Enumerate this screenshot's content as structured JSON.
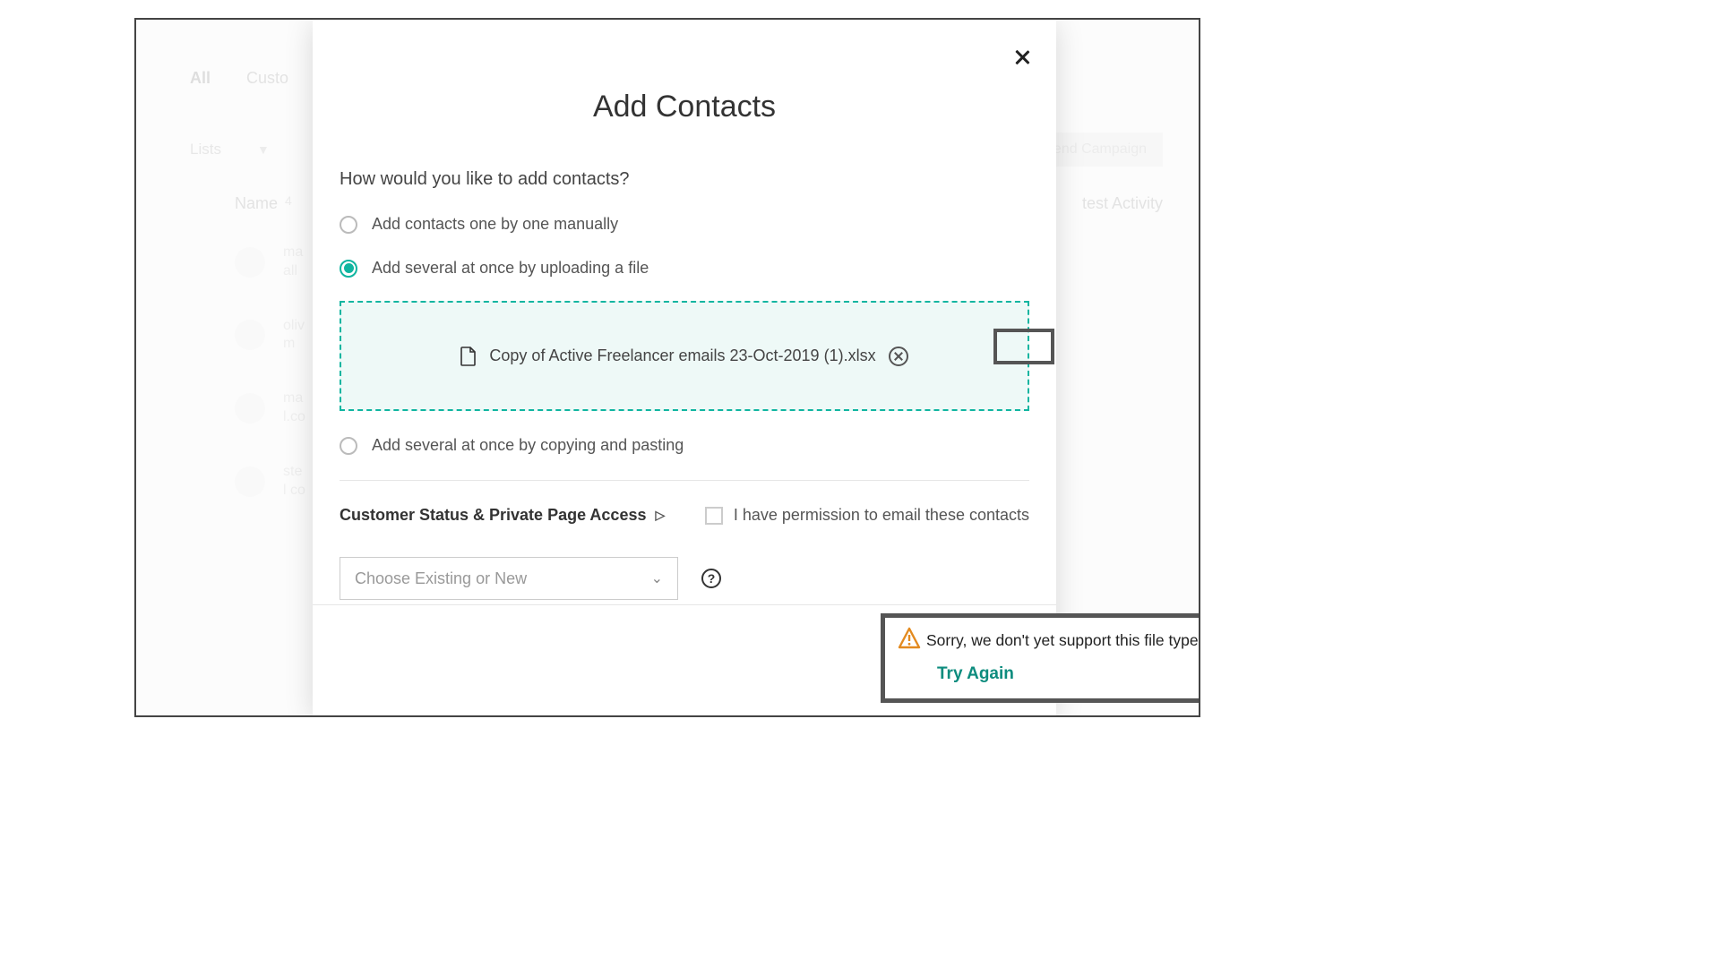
{
  "background": {
    "tabs": {
      "all": "All",
      "customers": "Custo"
    },
    "lists_label": "Lists",
    "send_campaign": "end Campaign",
    "columns": {
      "name": "Name",
      "count": "4",
      "latest": "test Activity"
    },
    "rows": [
      {
        "line1": "ma",
        "line2": "all"
      },
      {
        "line1": "oliv",
        "line2": "m"
      },
      {
        "line1": "ma",
        "line2": "l.co"
      },
      {
        "line1": "ste",
        "line2": "l co"
      }
    ]
  },
  "modal": {
    "title": "Add Contacts",
    "subhead": "How would you like to add contacts?",
    "options": {
      "manual": "Add contacts one by one manually",
      "upload": "Add several at once by uploading a file",
      "paste": "Add several at once by copying and pasting"
    },
    "file": {
      "name_prefix": "Copy of Active Freelancer emails 23-Oct-2019 (1",
      "ext": ").xlsx"
    },
    "status_label": "Customer Status & Private Page Access",
    "permission_label": "I have permission to email these contacts",
    "select_placeholder": "Choose Existing or New",
    "error": {
      "message": "Sorry, we don't yet support this file type",
      "action": "Try Again"
    }
  }
}
